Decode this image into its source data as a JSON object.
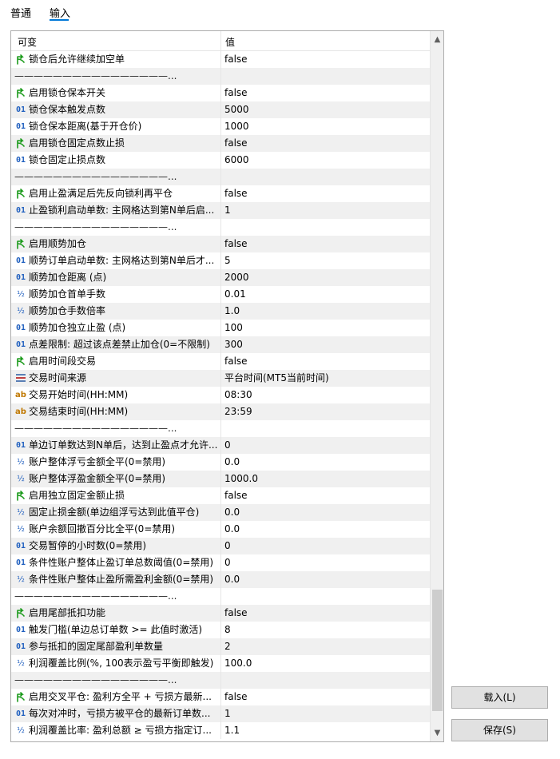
{
  "tabs": [
    {
      "label": "普通",
      "active": false
    },
    {
      "label": "输入",
      "active": true
    }
  ],
  "table": {
    "headers": {
      "name": "可变",
      "value": "值"
    },
    "rows": [
      {
        "icon": "bool-icon",
        "name": "锁仓后允许继续加空单",
        "value": "false"
      },
      {
        "icon": "",
        "name": "————————————————...",
        "value": ""
      },
      {
        "icon": "bool-icon",
        "name": "启用锁仓保本开关",
        "value": "false"
      },
      {
        "icon": "int-icon",
        "name": "锁仓保本触发点数",
        "value": "5000"
      },
      {
        "icon": "int-icon",
        "name": "锁仓保本距离(基于开仓价)",
        "value": "1000"
      },
      {
        "icon": "bool-icon",
        "name": "启用锁仓固定点数止损",
        "value": "false"
      },
      {
        "icon": "int-icon",
        "name": "锁仓固定止损点数",
        "value": "6000"
      },
      {
        "icon": "",
        "name": "————————————————...",
        "value": ""
      },
      {
        "icon": "bool-icon",
        "name": "启用止盈满足后先反向锁利再平仓",
        "value": "false"
      },
      {
        "icon": "int-icon",
        "name": "止盈锁利启动单数: 主网格达到第N单后启...",
        "value": "1"
      },
      {
        "icon": "",
        "name": "————————————————...",
        "value": ""
      },
      {
        "icon": "bool-icon",
        "name": "启用顺势加仓",
        "value": "false"
      },
      {
        "icon": "int-icon",
        "name": "顺势订单启动单数: 主网格达到第N单后才...",
        "value": "5"
      },
      {
        "icon": "int-icon",
        "name": "顺势加仓距离 (点)",
        "value": "2000"
      },
      {
        "icon": "double-icon",
        "name": "顺势加仓首单手数",
        "value": "0.01"
      },
      {
        "icon": "double-icon",
        "name": "顺势加仓手数倍率",
        "value": "1.0"
      },
      {
        "icon": "int-icon",
        "name": "顺势加仓独立止盈 (点)",
        "value": "100"
      },
      {
        "icon": "int-icon",
        "name": "点差限制: 超过该点差禁止加仓(0=不限制)",
        "value": "300"
      },
      {
        "icon": "bool-icon",
        "name": "启用时间段交易",
        "value": "false"
      },
      {
        "icon": "enum-icon",
        "name": "交易时间来源",
        "value": "平台时间(MT5当前时间)"
      },
      {
        "icon": "string-icon",
        "name": "交易开始时间(HH:MM)",
        "value": "08:30"
      },
      {
        "icon": "string-icon",
        "name": "交易结束时间(HH:MM)",
        "value": "23:59"
      },
      {
        "icon": "",
        "name": "————————————————...",
        "value": ""
      },
      {
        "icon": "int-icon",
        "name": "单边订单数达到N单后，达到止盈点才允许...",
        "value": "0"
      },
      {
        "icon": "double-icon",
        "name": "账户整体浮亏金额全平(0=禁用)",
        "value": "0.0"
      },
      {
        "icon": "double-icon",
        "name": "账户整体浮盈金额全平(0=禁用)",
        "value": "1000.0"
      },
      {
        "icon": "bool-icon",
        "name": "启用独立固定金额止损",
        "value": "false"
      },
      {
        "icon": "double-icon",
        "name": "固定止损金额(单边组浮亏达到此值平仓)",
        "value": "0.0"
      },
      {
        "icon": "double-icon",
        "name": "账户余额回撤百分比全平(0=禁用)",
        "value": "0.0"
      },
      {
        "icon": "int-icon",
        "name": "交易暂停的小时数(0=禁用)",
        "value": "0"
      },
      {
        "icon": "int-icon",
        "name": "条件性账户整体止盈订单总数阈值(0=禁用)",
        "value": "0"
      },
      {
        "icon": "double-icon",
        "name": "条件性账户整体止盈所需盈利金额(0=禁用)",
        "value": "0.0"
      },
      {
        "icon": "",
        "name": "————————————————...",
        "value": ""
      },
      {
        "icon": "bool-icon",
        "name": "启用尾部抵扣功能",
        "value": "false"
      },
      {
        "icon": "int-icon",
        "name": "触发门槛(单边总订单数 >= 此值时激活)",
        "value": "8"
      },
      {
        "icon": "int-icon",
        "name": "参与抵扣的固定尾部盈利单数量",
        "value": "2"
      },
      {
        "icon": "double-icon",
        "name": "利润覆盖比例(%, 100表示盈亏平衡即触发)",
        "value": "100.0"
      },
      {
        "icon": "",
        "name": "————————————————...",
        "value": ""
      },
      {
        "icon": "bool-icon",
        "name": "启用交叉平仓: 盈利方全平 + 亏损方最新...",
        "value": "false"
      },
      {
        "icon": "int-icon",
        "name": "每次对冲时，亏损方被平仓的最新订单数...",
        "value": "1"
      },
      {
        "icon": "double-icon",
        "name": "利润覆盖比率: 盈利总额 ≥ 亏损方指定订...",
        "value": "1.1"
      }
    ]
  },
  "icon_glyphs": {
    "int": "01",
    "double": "½",
    "string": "ab"
  },
  "buttons": {
    "load": "载入(L)",
    "save": "保存(S)"
  },
  "colors": {
    "accent": "#0078d7",
    "bool_icon": "#1a9a1a",
    "int_icon": "#1f5fbf",
    "string_icon": "#c07800"
  }
}
